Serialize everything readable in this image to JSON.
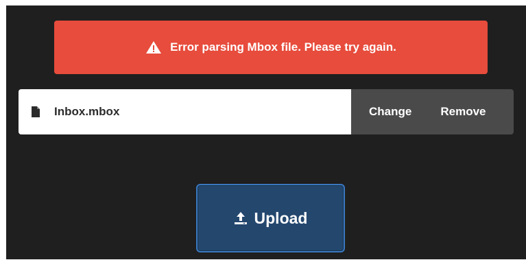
{
  "error_banner": {
    "message": "Error parsing Mbox file. Please try again.",
    "icon": "warning-icon",
    "color": "#e74c3c"
  },
  "file_row": {
    "file_name": "Inbox.mbox",
    "icon": "file-icon",
    "change_label": "Change",
    "remove_label": "Remove"
  },
  "upload": {
    "label": "Upload",
    "icon": "upload-icon",
    "color": "#24476e"
  },
  "colors": {
    "panel_background": "#1f1f1f",
    "actions_background": "#4a4a4a",
    "upload_border": "#3a78c0"
  }
}
